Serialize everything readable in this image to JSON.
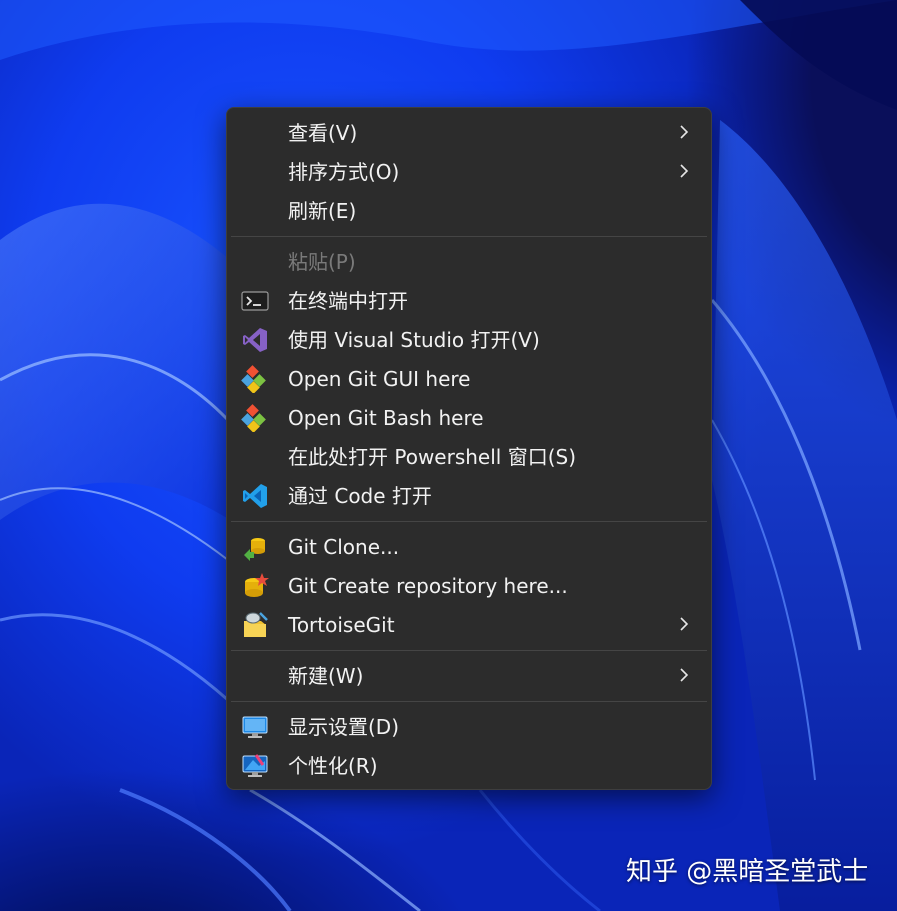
{
  "menu": {
    "items": [
      {
        "label": "查看(V)",
        "submenu": true
      },
      {
        "label": "排序方式(O)",
        "submenu": true
      },
      {
        "label": "刷新(E)"
      },
      {
        "label": "粘贴(P)",
        "disabled": true
      },
      {
        "label": "在终端中打开",
        "icon": "terminal-icon"
      },
      {
        "label": "使用 Visual Studio 打开(V)",
        "icon": "visual-studio-icon"
      },
      {
        "label": "Open Git GUI here",
        "icon": "git-gui-icon"
      },
      {
        "label": "Open Git Bash here",
        "icon": "git-bash-icon"
      },
      {
        "label": "在此处打开 Powershell 窗口(S)"
      },
      {
        "label": "通过 Code 打开",
        "icon": "vscode-icon"
      },
      {
        "label": "Git Clone...",
        "icon": "git-clone-icon"
      },
      {
        "label": "Git Create repository here...",
        "icon": "git-create-repo-icon"
      },
      {
        "label": "TortoiseGit",
        "icon": "tortoisegit-icon",
        "submenu": true
      },
      {
        "label": "新建(W)",
        "submenu": true
      },
      {
        "label": "显示设置(D)",
        "icon": "display-settings-icon"
      },
      {
        "label": "个性化(R)",
        "icon": "personalize-icon"
      }
    ]
  },
  "watermark": {
    "text": "知乎 @黑暗圣堂武士"
  },
  "colors": {
    "menu_bg": "#2c2c2c",
    "menu_text": "#f2f2f2",
    "disabled_text": "#7a7a7a",
    "separator": "#454545",
    "wallpaper_blue": "#0f3cf0"
  }
}
